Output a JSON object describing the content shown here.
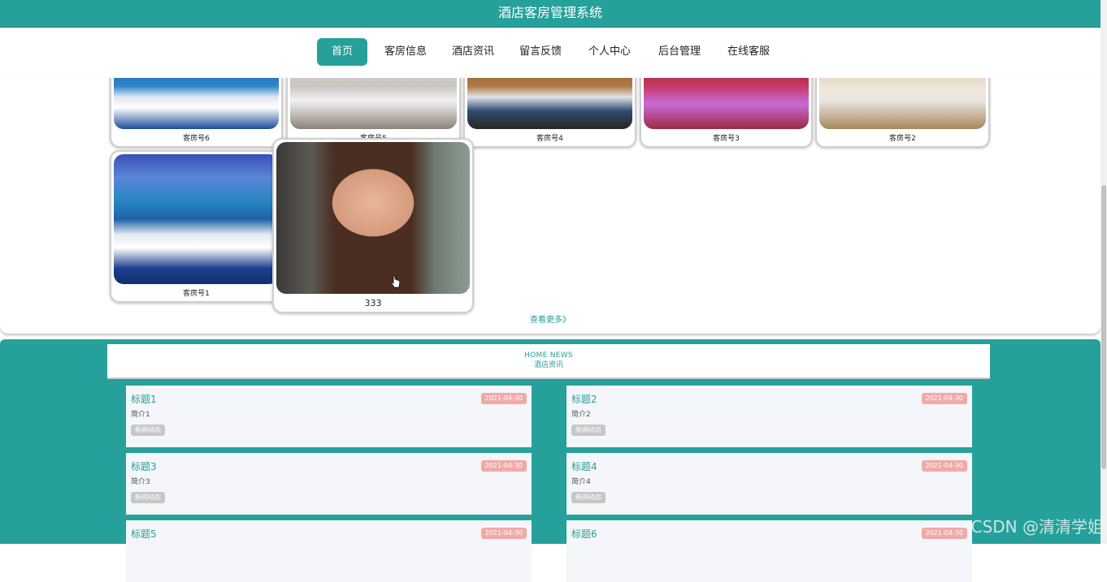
{
  "header": {
    "title": "酒店客房管理系统"
  },
  "nav": {
    "items": [
      {
        "label": "首页",
        "active": true
      },
      {
        "label": "客房信息"
      },
      {
        "label": "酒店资讯"
      },
      {
        "label": "留言反馈"
      },
      {
        "label": "个人中心"
      },
      {
        "label": "后台管理"
      },
      {
        "label": "在线客服"
      }
    ]
  },
  "rooms": {
    "items": [
      {
        "label": "客房号6"
      },
      {
        "label": "客房号5"
      },
      {
        "label": "客房号4"
      },
      {
        "label": "客房号3"
      },
      {
        "label": "客房号2"
      },
      {
        "label": "客房号1"
      },
      {
        "label": "333"
      }
    ],
    "more_label": "查看更多》"
  },
  "news": {
    "header_en": "HOME NEWS",
    "header_cn": "酒店资讯",
    "items": [
      {
        "title": "标题1",
        "date": "2021-04-30",
        "intro": "简介1",
        "tag": "新闻动态"
      },
      {
        "title": "标题2",
        "date": "2021-04-30",
        "intro": "简介2",
        "tag": "新闻动态"
      },
      {
        "title": "标题3",
        "date": "2021-04-30",
        "intro": "简介3",
        "tag": "新闻动态"
      },
      {
        "title": "标题4",
        "date": "2021-04-30",
        "intro": "简介4",
        "tag": "新闻动态"
      },
      {
        "title": "标题5",
        "date": "2021-04-30",
        "intro": "",
        "tag": ""
      },
      {
        "title": "标题6",
        "date": "2021-04-30",
        "intro": "",
        "tag": ""
      }
    ]
  },
  "watermark": "CSDN @清清学姐",
  "colors": {
    "accent": "#26a09a",
    "date_badge": "#f0aaa8",
    "tag_badge": "#c7c7c7",
    "news_card_bg": "#f4f6fa"
  }
}
